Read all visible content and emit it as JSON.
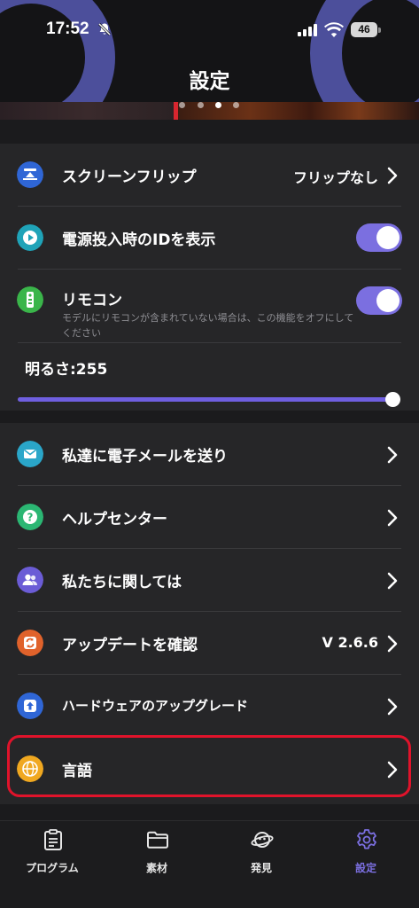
{
  "status_bar": {
    "time": "17:52",
    "battery": "46"
  },
  "header": {
    "title": "設定"
  },
  "carousel": {
    "count": 4,
    "active_index": 2
  },
  "display_section": {
    "screen_flip": {
      "label": "スクリーンフリップ",
      "value": "フリップなし",
      "icon": "screen-flip-icon"
    },
    "power_on_id": {
      "label": "電源投入時のIDを表示",
      "enabled": true,
      "icon": "play-icon"
    },
    "remote": {
      "label": "リモコン",
      "note": "モデルにリモコンが含まれていない場合は、この機能をオフにしてください",
      "enabled": true,
      "icon": "remote-icon"
    },
    "brightness": {
      "label": "明るさ:255",
      "value": 255,
      "max": 255
    }
  },
  "info_section": {
    "items": [
      {
        "label": "私達に電子メールを送り",
        "icon": "mail-icon",
        "value": ""
      },
      {
        "label": "ヘルプセンター",
        "icon": "help-icon",
        "value": ""
      },
      {
        "label": "私たちに関しては",
        "icon": "about-us-icon",
        "value": ""
      },
      {
        "label": "アップデートを確認",
        "icon": "update-icon",
        "value": "V 2.6.6"
      },
      {
        "label": "ハードウェアのアップグレード",
        "icon": "hardware-upgrade-icon",
        "value": ""
      },
      {
        "label": "言語",
        "icon": "globe-icon",
        "value": ""
      }
    ]
  },
  "tabbar": {
    "tabs": [
      {
        "label": "プログラム",
        "icon": "program-icon",
        "active": false
      },
      {
        "label": "素材",
        "icon": "folder-icon",
        "active": false
      },
      {
        "label": "発見",
        "icon": "discover-icon",
        "active": false
      },
      {
        "label": "設定",
        "icon": "gear-icon",
        "active": true
      }
    ]
  },
  "colors": {
    "accent": "#7b6fe0",
    "highlight_border": "#e0132b",
    "background": "#1b1b1d",
    "section": "#262628"
  }
}
